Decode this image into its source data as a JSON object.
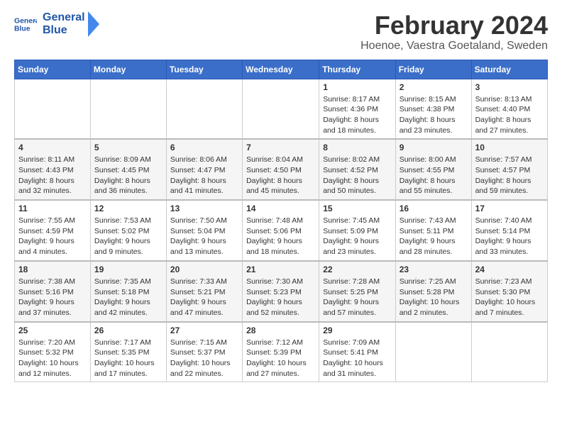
{
  "logo": {
    "text_general": "General",
    "text_blue": "Blue"
  },
  "title": "February 2024",
  "subtitle": "Hoenoe, Vaestra Goetaland, Sweden",
  "weekdays": [
    "Sunday",
    "Monday",
    "Tuesday",
    "Wednesday",
    "Thursday",
    "Friday",
    "Saturday"
  ],
  "weeks": [
    [
      {
        "day": "",
        "info": ""
      },
      {
        "day": "",
        "info": ""
      },
      {
        "day": "",
        "info": ""
      },
      {
        "day": "",
        "info": ""
      },
      {
        "day": "1",
        "info": "Sunrise: 8:17 AM\nSunset: 4:36 PM\nDaylight: 8 hours\nand 18 minutes."
      },
      {
        "day": "2",
        "info": "Sunrise: 8:15 AM\nSunset: 4:38 PM\nDaylight: 8 hours\nand 23 minutes."
      },
      {
        "day": "3",
        "info": "Sunrise: 8:13 AM\nSunset: 4:40 PM\nDaylight: 8 hours\nand 27 minutes."
      }
    ],
    [
      {
        "day": "4",
        "info": "Sunrise: 8:11 AM\nSunset: 4:43 PM\nDaylight: 8 hours\nand 32 minutes."
      },
      {
        "day": "5",
        "info": "Sunrise: 8:09 AM\nSunset: 4:45 PM\nDaylight: 8 hours\nand 36 minutes."
      },
      {
        "day": "6",
        "info": "Sunrise: 8:06 AM\nSunset: 4:47 PM\nDaylight: 8 hours\nand 41 minutes."
      },
      {
        "day": "7",
        "info": "Sunrise: 8:04 AM\nSunset: 4:50 PM\nDaylight: 8 hours\nand 45 minutes."
      },
      {
        "day": "8",
        "info": "Sunrise: 8:02 AM\nSunset: 4:52 PM\nDaylight: 8 hours\nand 50 minutes."
      },
      {
        "day": "9",
        "info": "Sunrise: 8:00 AM\nSunset: 4:55 PM\nDaylight: 8 hours\nand 55 minutes."
      },
      {
        "day": "10",
        "info": "Sunrise: 7:57 AM\nSunset: 4:57 PM\nDaylight: 8 hours\nand 59 minutes."
      }
    ],
    [
      {
        "day": "11",
        "info": "Sunrise: 7:55 AM\nSunset: 4:59 PM\nDaylight: 9 hours\nand 4 minutes."
      },
      {
        "day": "12",
        "info": "Sunrise: 7:53 AM\nSunset: 5:02 PM\nDaylight: 9 hours\nand 9 minutes."
      },
      {
        "day": "13",
        "info": "Sunrise: 7:50 AM\nSunset: 5:04 PM\nDaylight: 9 hours\nand 13 minutes."
      },
      {
        "day": "14",
        "info": "Sunrise: 7:48 AM\nSunset: 5:06 PM\nDaylight: 9 hours\nand 18 minutes."
      },
      {
        "day": "15",
        "info": "Sunrise: 7:45 AM\nSunset: 5:09 PM\nDaylight: 9 hours\nand 23 minutes."
      },
      {
        "day": "16",
        "info": "Sunrise: 7:43 AM\nSunset: 5:11 PM\nDaylight: 9 hours\nand 28 minutes."
      },
      {
        "day": "17",
        "info": "Sunrise: 7:40 AM\nSunset: 5:14 PM\nDaylight: 9 hours\nand 33 minutes."
      }
    ],
    [
      {
        "day": "18",
        "info": "Sunrise: 7:38 AM\nSunset: 5:16 PM\nDaylight: 9 hours\nand 37 minutes."
      },
      {
        "day": "19",
        "info": "Sunrise: 7:35 AM\nSunset: 5:18 PM\nDaylight: 9 hours\nand 42 minutes."
      },
      {
        "day": "20",
        "info": "Sunrise: 7:33 AM\nSunset: 5:21 PM\nDaylight: 9 hours\nand 47 minutes."
      },
      {
        "day": "21",
        "info": "Sunrise: 7:30 AM\nSunset: 5:23 PM\nDaylight: 9 hours\nand 52 minutes."
      },
      {
        "day": "22",
        "info": "Sunrise: 7:28 AM\nSunset: 5:25 PM\nDaylight: 9 hours\nand 57 minutes."
      },
      {
        "day": "23",
        "info": "Sunrise: 7:25 AM\nSunset: 5:28 PM\nDaylight: 10 hours\nand 2 minutes."
      },
      {
        "day": "24",
        "info": "Sunrise: 7:23 AM\nSunset: 5:30 PM\nDaylight: 10 hours\nand 7 minutes."
      }
    ],
    [
      {
        "day": "25",
        "info": "Sunrise: 7:20 AM\nSunset: 5:32 PM\nDaylight: 10 hours\nand 12 minutes."
      },
      {
        "day": "26",
        "info": "Sunrise: 7:17 AM\nSunset: 5:35 PM\nDaylight: 10 hours\nand 17 minutes."
      },
      {
        "day": "27",
        "info": "Sunrise: 7:15 AM\nSunset: 5:37 PM\nDaylight: 10 hours\nand 22 minutes."
      },
      {
        "day": "28",
        "info": "Sunrise: 7:12 AM\nSunset: 5:39 PM\nDaylight: 10 hours\nand 27 minutes."
      },
      {
        "day": "29",
        "info": "Sunrise: 7:09 AM\nSunset: 5:41 PM\nDaylight: 10 hours\nand 31 minutes."
      },
      {
        "day": "",
        "info": ""
      },
      {
        "day": "",
        "info": ""
      }
    ]
  ]
}
